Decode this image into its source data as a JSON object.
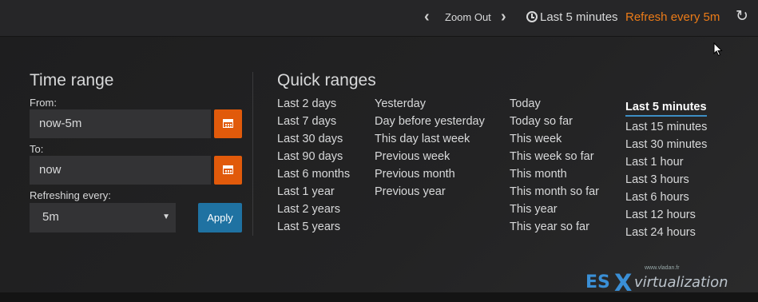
{
  "topbar": {
    "zoom_out_label": "Zoom Out",
    "time_label": "Last 5 minutes",
    "refresh_label": "Refresh every 5m",
    "icons": [
      "chevron-left-icon",
      "chevron-right-icon",
      "clock-icon",
      "sync-icon"
    ],
    "refresh_color": "#eb7b18"
  },
  "time_range": {
    "title": "Time range",
    "from_label": "From:",
    "from_value": "now-5m",
    "to_label": "To:",
    "to_value": "now",
    "refresh_label": "Refreshing every:",
    "refresh_value": "5m",
    "apply_label": "Apply",
    "calendar_button_color": "#e15a0b",
    "apply_button_color": "#1f72a2"
  },
  "quick_ranges": {
    "title": "Quick ranges",
    "columns": [
      [
        "Last 2 days",
        "Last 7 days",
        "Last 30 days",
        "Last 90 days",
        "Last 6 months",
        "Last 1 year",
        "Last 2 years",
        "Last 5 years"
      ],
      [
        "Yesterday",
        "Day before yesterday",
        "This day last week",
        "Previous week",
        "Previous month",
        "Previous year"
      ],
      [
        "Today",
        "Today so far",
        "This week",
        "This week so far",
        "This month",
        "This month so far",
        "This year",
        "This year so far"
      ],
      [
        "Last 5 minutes",
        "Last 15 minutes",
        "Last 30 minutes",
        "Last 1 hour",
        "Last 3 hours",
        "Last 6 hours",
        "Last 12 hours",
        "Last 24 hours"
      ]
    ],
    "active": "Last 5 minutes"
  },
  "watermark": {
    "small_text": "www.vladan.fr",
    "es": "ES",
    "x": "X",
    "rest": "virtualization"
  }
}
